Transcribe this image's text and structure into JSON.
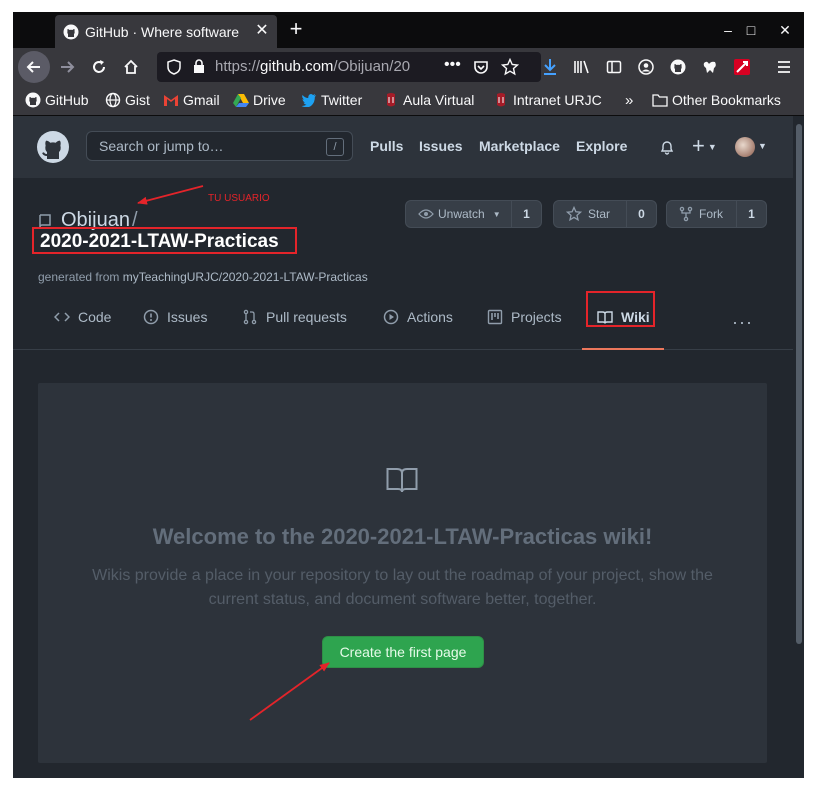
{
  "browser": {
    "tab_title": "GitHub · Where software",
    "tab_close": "✕",
    "new_tab": "+",
    "url_prefix": "https://",
    "url_host": "github.com",
    "url_path": "/Obijuan/20",
    "window_controls": {
      "minimize": "–",
      "maximize": "□",
      "close": "✕"
    }
  },
  "bookmarks": [
    {
      "label": "GitHub",
      "icon": "github-icon"
    },
    {
      "label": "Gist",
      "icon": "globe-icon"
    },
    {
      "label": "Gmail",
      "icon": "gmail-icon"
    },
    {
      "label": "Drive",
      "icon": "drive-icon"
    },
    {
      "label": "Twitter",
      "icon": "twitter-icon"
    },
    {
      "label": "Aula Virtual",
      "icon": "urjc-icon"
    },
    {
      "label": "Intranet URJC",
      "icon": "urjc-icon"
    },
    {
      "label": "Other Bookmarks",
      "icon": "folder-icon"
    }
  ],
  "header": {
    "search_placeholder": "Search or jump to…",
    "search_shortcut": "/",
    "links": [
      "Pulls",
      "Issues",
      "Marketplace",
      "Explore"
    ]
  },
  "repo": {
    "owner": "Obijuan",
    "separator": "/",
    "name": "2020-2021-LTAW-Practicas",
    "generated_prefix": "generated from ",
    "generated_link": "myTeachingURJC/2020-2021-LTAW-Practicas",
    "annotation": "TU USUARIO",
    "watch": {
      "label": "Unwatch",
      "count": "1"
    },
    "star": {
      "label": "Star",
      "count": "0"
    },
    "fork": {
      "label": "Fork",
      "count": "1"
    }
  },
  "repo_nav": {
    "tabs": [
      {
        "label": "Code",
        "icon": "code-icon"
      },
      {
        "label": "Issues",
        "icon": "issue-icon"
      },
      {
        "label": "Pull requests",
        "icon": "pull-request-icon"
      },
      {
        "label": "Actions",
        "icon": "play-icon"
      },
      {
        "label": "Projects",
        "icon": "project-icon"
      },
      {
        "label": "Wiki",
        "icon": "book-icon"
      }
    ],
    "active": "Wiki",
    "more": "···"
  },
  "wiki": {
    "heading": "Welcome to the 2020-2021-LTAW-Practicas wiki!",
    "description": "Wikis provide a place in your repository to lay out the roadmap of your project, show the current status, and document software better, together.",
    "create_button": "Create the first page"
  },
  "colors": {
    "accent_red": "#e4242a",
    "button_green": "#2ea44f",
    "page_bg": "#22272e"
  }
}
